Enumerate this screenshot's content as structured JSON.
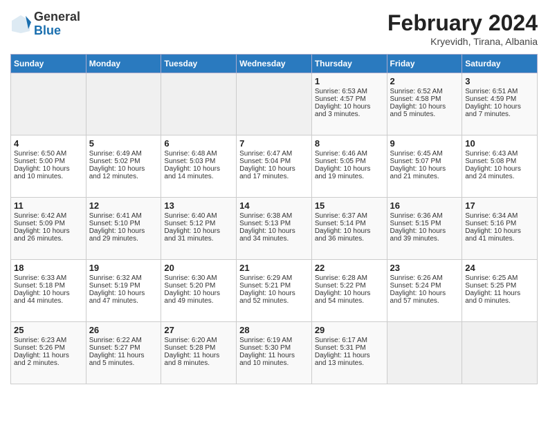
{
  "header": {
    "logo_line1": "General",
    "logo_line2": "Blue",
    "title": "February 2024",
    "subtitle": "Kryevidh, Tirana, Albania"
  },
  "weekdays": [
    "Sunday",
    "Monday",
    "Tuesday",
    "Wednesday",
    "Thursday",
    "Friday",
    "Saturday"
  ],
  "weeks": [
    [
      {
        "day": "",
        "empty": true
      },
      {
        "day": "",
        "empty": true
      },
      {
        "day": "",
        "empty": true
      },
      {
        "day": "",
        "empty": true
      },
      {
        "day": "1",
        "line1": "Sunrise: 6:53 AM",
        "line2": "Sunset: 4:57 PM",
        "line3": "Daylight: 10 hours",
        "line4": "and 3 minutes."
      },
      {
        "day": "2",
        "line1": "Sunrise: 6:52 AM",
        "line2": "Sunset: 4:58 PM",
        "line3": "Daylight: 10 hours",
        "line4": "and 5 minutes."
      },
      {
        "day": "3",
        "line1": "Sunrise: 6:51 AM",
        "line2": "Sunset: 4:59 PM",
        "line3": "Daylight: 10 hours",
        "line4": "and 7 minutes."
      }
    ],
    [
      {
        "day": "4",
        "line1": "Sunrise: 6:50 AM",
        "line2": "Sunset: 5:00 PM",
        "line3": "Daylight: 10 hours",
        "line4": "and 10 minutes."
      },
      {
        "day": "5",
        "line1": "Sunrise: 6:49 AM",
        "line2": "Sunset: 5:02 PM",
        "line3": "Daylight: 10 hours",
        "line4": "and 12 minutes."
      },
      {
        "day": "6",
        "line1": "Sunrise: 6:48 AM",
        "line2": "Sunset: 5:03 PM",
        "line3": "Daylight: 10 hours",
        "line4": "and 14 minutes."
      },
      {
        "day": "7",
        "line1": "Sunrise: 6:47 AM",
        "line2": "Sunset: 5:04 PM",
        "line3": "Daylight: 10 hours",
        "line4": "and 17 minutes."
      },
      {
        "day": "8",
        "line1": "Sunrise: 6:46 AM",
        "line2": "Sunset: 5:05 PM",
        "line3": "Daylight: 10 hours",
        "line4": "and 19 minutes."
      },
      {
        "day": "9",
        "line1": "Sunrise: 6:45 AM",
        "line2": "Sunset: 5:07 PM",
        "line3": "Daylight: 10 hours",
        "line4": "and 21 minutes."
      },
      {
        "day": "10",
        "line1": "Sunrise: 6:43 AM",
        "line2": "Sunset: 5:08 PM",
        "line3": "Daylight: 10 hours",
        "line4": "and 24 minutes."
      }
    ],
    [
      {
        "day": "11",
        "line1": "Sunrise: 6:42 AM",
        "line2": "Sunset: 5:09 PM",
        "line3": "Daylight: 10 hours",
        "line4": "and 26 minutes."
      },
      {
        "day": "12",
        "line1": "Sunrise: 6:41 AM",
        "line2": "Sunset: 5:10 PM",
        "line3": "Daylight: 10 hours",
        "line4": "and 29 minutes."
      },
      {
        "day": "13",
        "line1": "Sunrise: 6:40 AM",
        "line2": "Sunset: 5:12 PM",
        "line3": "Daylight: 10 hours",
        "line4": "and 31 minutes."
      },
      {
        "day": "14",
        "line1": "Sunrise: 6:38 AM",
        "line2": "Sunset: 5:13 PM",
        "line3": "Daylight: 10 hours",
        "line4": "and 34 minutes."
      },
      {
        "day": "15",
        "line1": "Sunrise: 6:37 AM",
        "line2": "Sunset: 5:14 PM",
        "line3": "Daylight: 10 hours",
        "line4": "and 36 minutes."
      },
      {
        "day": "16",
        "line1": "Sunrise: 6:36 AM",
        "line2": "Sunset: 5:15 PM",
        "line3": "Daylight: 10 hours",
        "line4": "and 39 minutes."
      },
      {
        "day": "17",
        "line1": "Sunrise: 6:34 AM",
        "line2": "Sunset: 5:16 PM",
        "line3": "Daylight: 10 hours",
        "line4": "and 41 minutes."
      }
    ],
    [
      {
        "day": "18",
        "line1": "Sunrise: 6:33 AM",
        "line2": "Sunset: 5:18 PM",
        "line3": "Daylight: 10 hours",
        "line4": "and 44 minutes."
      },
      {
        "day": "19",
        "line1": "Sunrise: 6:32 AM",
        "line2": "Sunset: 5:19 PM",
        "line3": "Daylight: 10 hours",
        "line4": "and 47 minutes."
      },
      {
        "day": "20",
        "line1": "Sunrise: 6:30 AM",
        "line2": "Sunset: 5:20 PM",
        "line3": "Daylight: 10 hours",
        "line4": "and 49 minutes."
      },
      {
        "day": "21",
        "line1": "Sunrise: 6:29 AM",
        "line2": "Sunset: 5:21 PM",
        "line3": "Daylight: 10 hours",
        "line4": "and 52 minutes."
      },
      {
        "day": "22",
        "line1": "Sunrise: 6:28 AM",
        "line2": "Sunset: 5:22 PM",
        "line3": "Daylight: 10 hours",
        "line4": "and 54 minutes."
      },
      {
        "day": "23",
        "line1": "Sunrise: 6:26 AM",
        "line2": "Sunset: 5:24 PM",
        "line3": "Daylight: 10 hours",
        "line4": "and 57 minutes."
      },
      {
        "day": "24",
        "line1": "Sunrise: 6:25 AM",
        "line2": "Sunset: 5:25 PM",
        "line3": "Daylight: 11 hours",
        "line4": "and 0 minutes."
      }
    ],
    [
      {
        "day": "25",
        "line1": "Sunrise: 6:23 AM",
        "line2": "Sunset: 5:26 PM",
        "line3": "Daylight: 11 hours",
        "line4": "and 2 minutes."
      },
      {
        "day": "26",
        "line1": "Sunrise: 6:22 AM",
        "line2": "Sunset: 5:27 PM",
        "line3": "Daylight: 11 hours",
        "line4": "and 5 minutes."
      },
      {
        "day": "27",
        "line1": "Sunrise: 6:20 AM",
        "line2": "Sunset: 5:28 PM",
        "line3": "Daylight: 11 hours",
        "line4": "and 8 minutes."
      },
      {
        "day": "28",
        "line1": "Sunrise: 6:19 AM",
        "line2": "Sunset: 5:30 PM",
        "line3": "Daylight: 11 hours",
        "line4": "and 10 minutes."
      },
      {
        "day": "29",
        "line1": "Sunrise: 6:17 AM",
        "line2": "Sunset: 5:31 PM",
        "line3": "Daylight: 11 hours",
        "line4": "and 13 minutes."
      },
      {
        "day": "",
        "empty": true
      },
      {
        "day": "",
        "empty": true
      }
    ]
  ]
}
